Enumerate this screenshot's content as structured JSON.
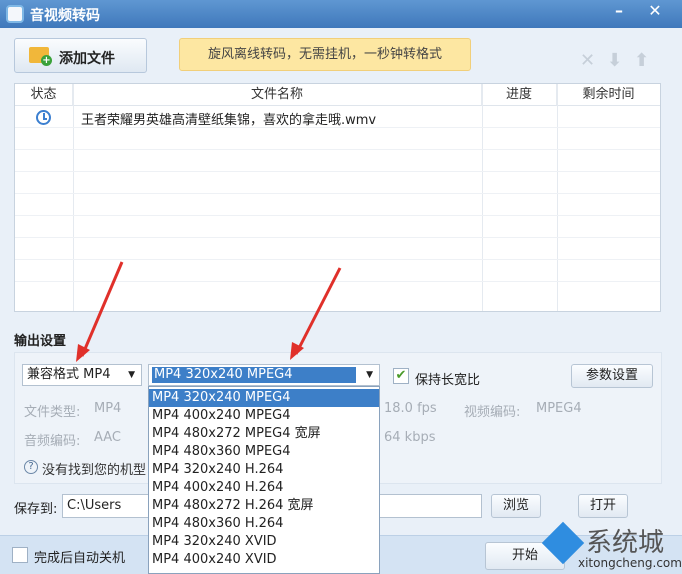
{
  "window": {
    "title": "音视频转码",
    "minimize": "–",
    "close": "✕"
  },
  "toolbar": {
    "add_file": "添加文件",
    "banner": "旋风离线转码，无需挂机，一秒钟转格式",
    "delete": "✕",
    "move_down": "⬇",
    "move_up": "⬆"
  },
  "table": {
    "headers": [
      "状态",
      "文件名称",
      "进度",
      "剩余时间"
    ],
    "rows": [
      {
        "status_icon": "clock-icon",
        "name": "王者荣耀男英雄高清壁纸集锦，喜欢的拿走哦.wmv",
        "progress": "",
        "remaining": ""
      }
    ]
  },
  "output": {
    "label": "输出设置",
    "format": "兼容格式 MP4",
    "profile": "MP4 320x240 MPEG4",
    "keep_ratio": "保持长宽比",
    "keep_ratio_checked": true,
    "params_button": "参数设置",
    "file_type_label": "文件类型:",
    "file_type": "MP4",
    "fps": "18.0 fps",
    "video_codec_label": "视频编码:",
    "video_codec": "MPEG4",
    "audio_codec_label": "音频编码:",
    "audio_codec": "AAC",
    "bitrate": "64 kbps",
    "help": "没有找到您的机型"
  },
  "profile_options": [
    "MP4 320x240 MPEG4",
    "MP4 400x240 MPEG4",
    "MP4 480x272 MPEG4 宽屏",
    "MP4 480x360 MPEG4",
    "MP4 320x240 H.264",
    "MP4 400x240 H.264",
    "MP4 480x272 H.264 宽屏",
    "MP4 480x360 H.264",
    "MP4 320x240 XVID",
    "MP4 400x240 XVID"
  ],
  "save": {
    "label": "保存到:",
    "path": "C:\\Users",
    "browse": "浏览",
    "open": "打开"
  },
  "bottom": {
    "auto_shutdown": "完成后自动关机",
    "start": "开始"
  },
  "watermark": {
    "brand": "系统城",
    "url": "xitongcheng.com"
  }
}
